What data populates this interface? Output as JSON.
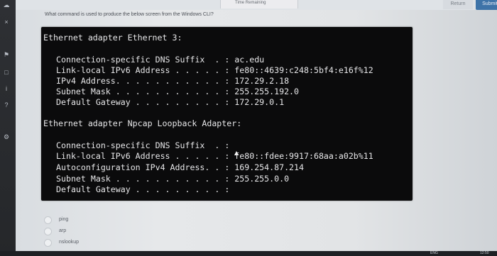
{
  "header": {
    "timer_label": "Time Remaining",
    "return_label": "Return",
    "submit_label": "Submit"
  },
  "question": {
    "text": "What command is used to produce the below screen from the Windows CLI?"
  },
  "terminal": {
    "adapter1_title": "Ethernet adapter Ethernet 3:",
    "adapter1_lines": [
      "Connection-specific DNS Suffix  . : ac.edu",
      "Link-local IPv6 Address . . . . . : fe80::4639:c248:5bf4:e16f%12",
      "IPv4 Address. . . . . . . . . . . : 172.29.2.18",
      "Subnet Mask . . . . . . . . . . . : 255.255.192.0",
      "Default Gateway . . . . . . . . . : 172.29.0.1"
    ],
    "adapter2_title": "Ethernet adapter Npcap Loopback Adapter:",
    "adapter2_lines": [
      "Connection-specific DNS Suffix  . :",
      "Link-local IPv6 Address . . . . . : fe80::fdee:9917:68aa:a02b%11",
      "Autoconfiguration IPv4 Address. . : 169.254.87.214",
      "Subnet Mask . . . . . . . . . . . : 255.255.0.0",
      "Default Gateway . . . . . . . . . :"
    ]
  },
  "options": [
    "ping",
    "arp",
    "nslookup"
  ],
  "taskbar": {
    "lang": "ENG",
    "time": "12:50"
  },
  "colors": {
    "submit": "#3e73a8",
    "terminal_bg": "#0b0b0c",
    "terminal_fg": "#e7e7e9"
  }
}
